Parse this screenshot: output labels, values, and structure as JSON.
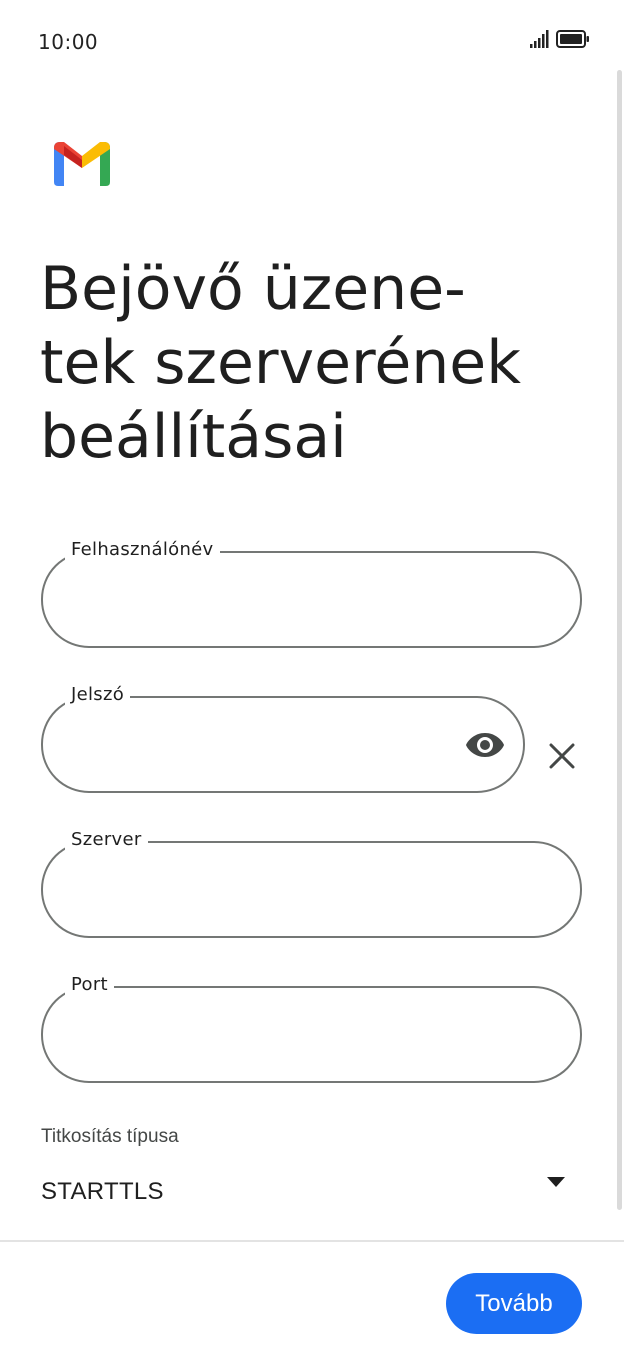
{
  "status_bar": {
    "time": "10:00",
    "icons": [
      "signal-icon",
      "battery-icon"
    ]
  },
  "app": {
    "logo": "gmail-logo",
    "title": "Bejövő üzene-\ntek szerverének\nbeállításai"
  },
  "form": {
    "username": {
      "label": "Felhasználónév",
      "value": ""
    },
    "password": {
      "label": "Jelszó",
      "value": "",
      "toggle_icon": "eye-icon",
      "clear_icon": "close-icon"
    },
    "server": {
      "label": "Szerver",
      "value": ""
    },
    "port": {
      "label": "Port",
      "value": ""
    },
    "encryption": {
      "label": "Titkosítás típusa",
      "selected": "STARTTLS",
      "icon": "dropdown-arrow-icon"
    }
  },
  "footer": {
    "next_label": "Tovább"
  },
  "colors": {
    "accent": "#1b6ef3",
    "outline": "#747775",
    "text": "#1f1f1f"
  }
}
